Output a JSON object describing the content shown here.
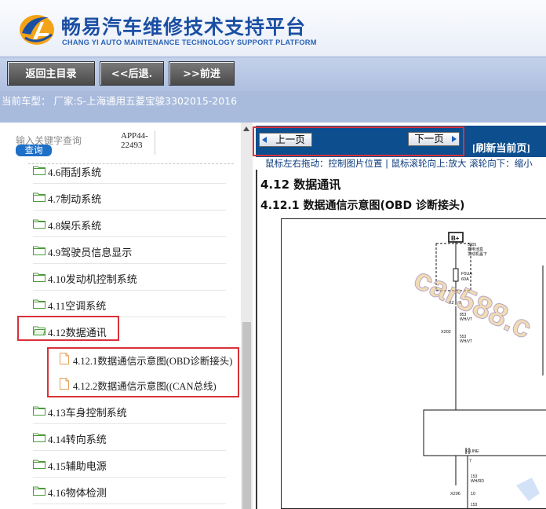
{
  "header": {
    "brand_cn": "畅易汽车维修技术支持平台",
    "brand_en": "CHANG YI AUTO MAINTENANCE TECHNOLOGY SUPPORT PLATFORM"
  },
  "toolbar": {
    "home": "返回主目录",
    "back": "<<后退.",
    "forward": ">>前进"
  },
  "car_line": "当前车型： 厂家:S-上海通用五菱宝骏3302015-2016",
  "search": {
    "placeholder": "输入关键字查询",
    "button": "查询",
    "app_code_1": "APP44-",
    "app_code_2": "22493"
  },
  "tree": {
    "items": [
      {
        "label": "4.6雨刮系统"
      },
      {
        "label": "4.7制动系统"
      },
      {
        "label": "4.8娱乐系统"
      },
      {
        "label": "4.9驾驶员信息显示"
      },
      {
        "label": "4.10发动机控制系统"
      },
      {
        "label": "4.11空调系统"
      },
      {
        "label": "4.12数据通讯",
        "selected": true
      },
      {
        "label": "4.13车身控制系统"
      },
      {
        "label": "4.14转向系统"
      },
      {
        "label": "4.15辅助电源"
      },
      {
        "label": "4.16物体检测"
      }
    ],
    "sub_items": [
      {
        "label": "4.12.1数据通信示意图(OBD诊断接头)"
      },
      {
        "label": "4.12.2数据通信示意图((CAN总线)"
      }
    ]
  },
  "viewer": {
    "prev": "上一页",
    "next": "下一页",
    "refresh": "[刷新当前页]",
    "hint": "鼠标左右拖动：控制图片位置 | 鼠标滚轮向上:放大  滚轮向下：缩小",
    "title": "4.12 数据通讯",
    "subtitle": "4.12.1 数据通信示意图(OBD 诊断接头)"
  },
  "diagram": {
    "battery_label": "B+",
    "fuse_note_1": "3305",
    "fuse_note_2": "蓄电池盒",
    "fuse_note_3": "发动机盖下",
    "fuse": "F5UA",
    "fuse_amp": "60A",
    "conn_x2": "X2",
    "pin_2": "2",
    "wire_1_num": "853",
    "wire_1_color": "WH/VT",
    "conn_x202": "X202",
    "wire_2_num": "553",
    "wire_2_color": "WH/VT",
    "kline": "K-LINE",
    "pin_7": "7",
    "wire_3_num": "153",
    "wire_3_color": "WH/RD",
    "conn_x206": "X206",
    "pin_10": "10",
    "wire_4_num": "153",
    "watermark": "car588.c"
  },
  "colors": {
    "brand_blue": "#1b4fa3",
    "highlight_red": "#d9323a",
    "nav_blue": "#0c4e8e",
    "toolbar_bg": "#b6c6e4"
  }
}
